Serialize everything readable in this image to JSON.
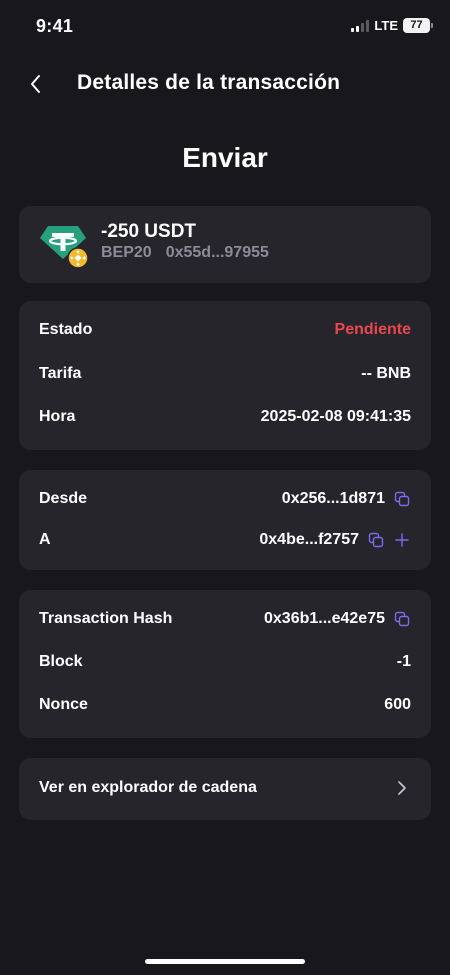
{
  "status_bar": {
    "time": "9:41",
    "network": "LTE",
    "battery": "77"
  },
  "header": {
    "title": "Detalles de la transacción"
  },
  "page": {
    "title": "Enviar"
  },
  "token": {
    "amount": "-250 USDT",
    "network": "BEP20",
    "address": "0x55d...97955"
  },
  "details": {
    "status_label": "Estado",
    "status_value": "Pendiente",
    "fee_label": "Tarifa",
    "fee_value": "-- BNB",
    "time_label": "Hora",
    "time_value": "2025-02-08 09:41:35"
  },
  "addresses": {
    "from_label": "Desde",
    "from_value": "0x256...1d871",
    "to_label": "A",
    "to_value": "0x4be...f2757"
  },
  "chain_info": {
    "hash_label": "Transaction Hash",
    "hash_value": "0x36b1...e42e75",
    "block_label": "Block",
    "block_value": "-1",
    "nonce_label": "Nonce",
    "nonce_value": "600"
  },
  "explorer": {
    "label": "Ver en explorador de cadena"
  },
  "colors": {
    "background": "#17171c",
    "card": "#25252b",
    "pending": "#e9484e",
    "accent": "#7b6cf0",
    "tether": "#26a17b",
    "bnb": "#f3ba2f"
  },
  "icons": [
    "chevron-left-icon",
    "copy-icon",
    "plus-icon",
    "chevron-right-icon",
    "tether-icon",
    "bnb-icon"
  ]
}
